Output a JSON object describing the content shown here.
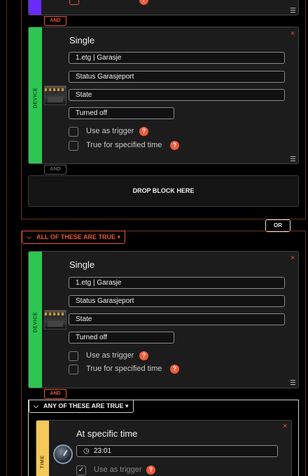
{
  "connectors": {
    "and": "AND",
    "or": "OR"
  },
  "drop_block": "DROP BLOCK HERE",
  "block1": {
    "strip_label": "DEVICE",
    "title": "Single",
    "fields": [
      "1.etg | Garasje",
      "Status Garasjeport",
      "State",
      "Turned off"
    ],
    "use_as_trigger": "Use as trigger",
    "true_for_time": "True for specified time",
    "help": "?",
    "close": "×"
  },
  "group_all": {
    "label": "ALL OF THESE ARE TRUE",
    "chevron": "▾"
  },
  "block2": {
    "strip_label": "DEVICE",
    "title": "Single",
    "fields": [
      "1.etg | Garasje",
      "Status Garasjeport",
      "State",
      "Turned off"
    ],
    "use_as_trigger": "Use as trigger",
    "true_for_time": "True for specified time",
    "help": "?",
    "close": "×"
  },
  "group_any": {
    "label": "ANY OF THESE ARE TRUE",
    "chevron": "▾"
  },
  "block3": {
    "strip_label": "TIME",
    "title": "At specific time",
    "time_value": "23:01",
    "use_as_trigger": "Use as trigger",
    "help": "?",
    "close": "×",
    "checked_mark": "✓"
  },
  "colors": {
    "accent": "#e8553a",
    "device_strip": "#2dc653",
    "time_strip": "#f5c85a",
    "top_strip": "#6a2bff"
  }
}
